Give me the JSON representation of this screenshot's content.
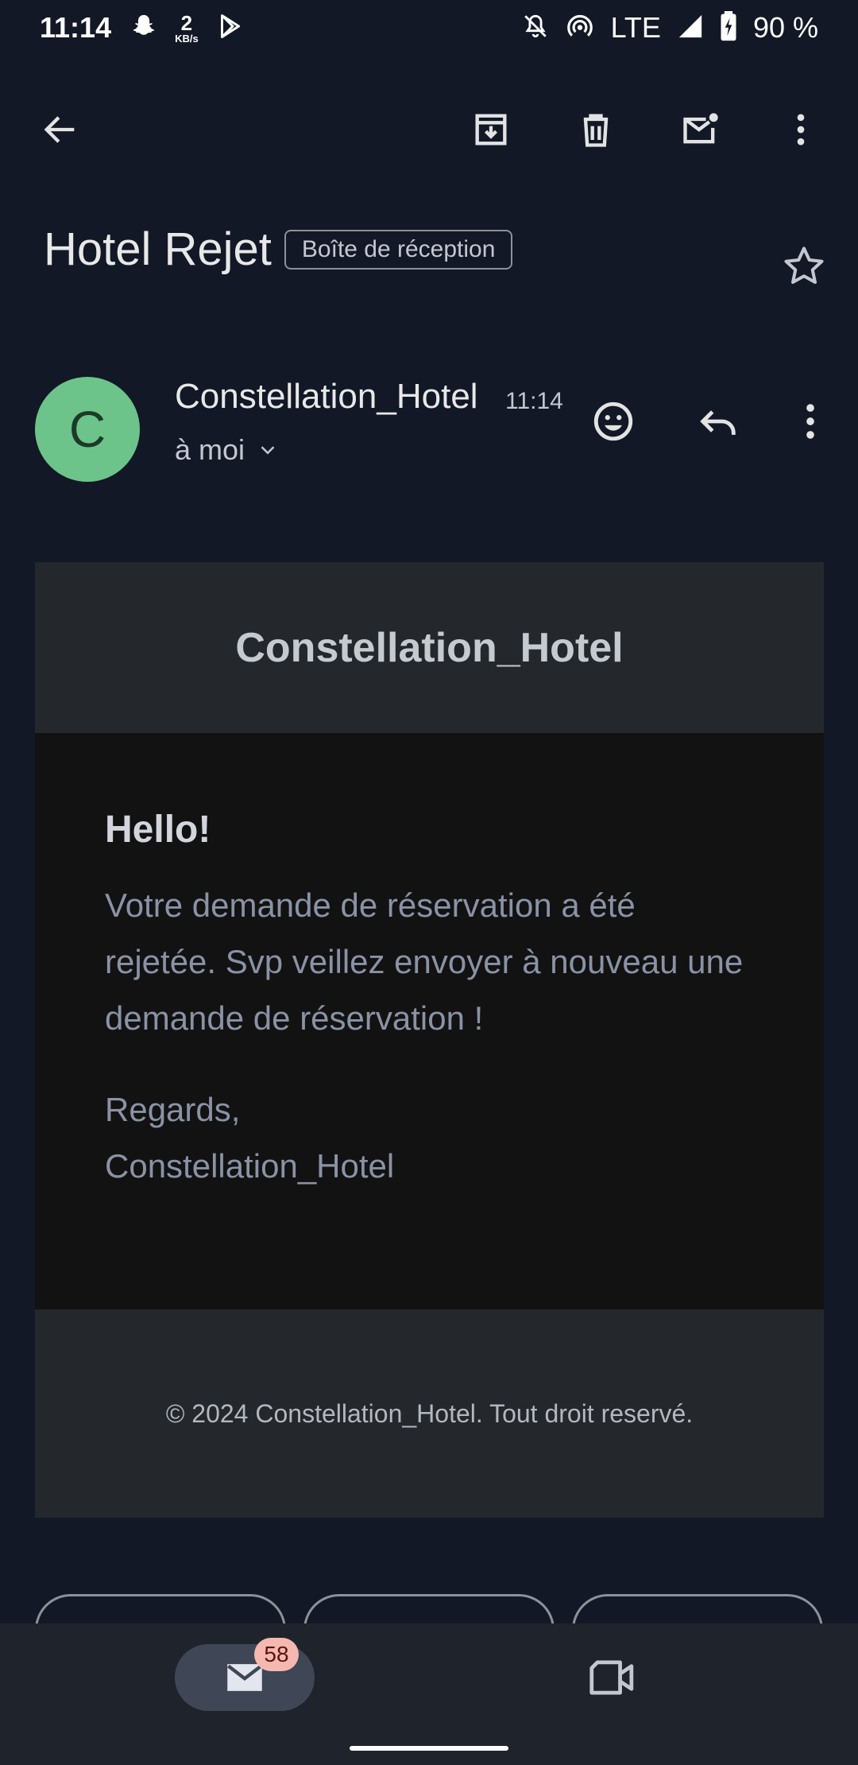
{
  "status_bar": {
    "time": "11:14",
    "network_speed_value": "2",
    "network_speed_unit": "KB/s",
    "network_type": "LTE",
    "battery": "90 %",
    "icons": [
      "snapchat-icon",
      "play-store-icon",
      "do-not-disturb-icon",
      "hotspot-icon",
      "signal-icon",
      "battery-charging-icon"
    ]
  },
  "toolbar": {
    "icons": [
      "back-arrow-icon",
      "archive-icon",
      "delete-icon",
      "mark-unread-icon",
      "more-vert-icon"
    ]
  },
  "email": {
    "subject": "Hotel Rejet",
    "label": "Boîte de réception",
    "sender": {
      "initial": "C",
      "name": "Constellation_Hotel",
      "time": "11:14",
      "recipient": "à moi"
    },
    "body": {
      "header_title": "Constellation_Hotel",
      "greeting": "Hello!",
      "message": "Votre demande de réservation a été rejetée. Svp veillez envoyer à nouveau une demande de réservation !",
      "sign_off": "Regards,",
      "signature": "Constellation_Hotel",
      "footer": "© 2024 Constellation_Hotel. Tout droit reservé."
    }
  },
  "bottom_nav": {
    "mail_badge": "58",
    "items": [
      "mail-icon",
      "meet-video-icon"
    ]
  },
  "colors": {
    "background": "#121826",
    "avatar": "#6cc48a",
    "email_header": "#24282c",
    "email_main": "#121212",
    "badge": "#f4b8b0"
  }
}
